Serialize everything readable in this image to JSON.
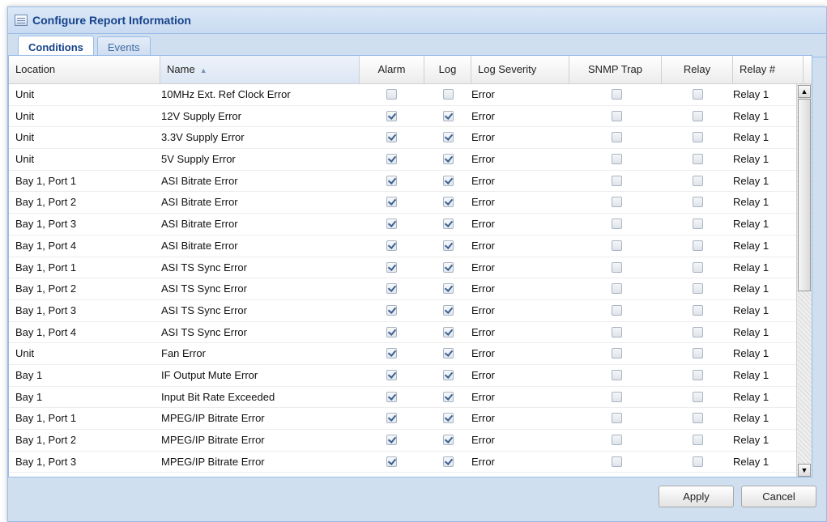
{
  "window": {
    "title": "Configure Report Information"
  },
  "tabs": [
    {
      "label": "Conditions",
      "active": true
    },
    {
      "label": "Events",
      "active": false
    }
  ],
  "grid": {
    "columns": [
      {
        "key": "location",
        "label": "Location"
      },
      {
        "key": "name",
        "label": "Name",
        "sorted": "asc"
      },
      {
        "key": "alarm",
        "label": "Alarm"
      },
      {
        "key": "log",
        "label": "Log"
      },
      {
        "key": "severity",
        "label": "Log Severity"
      },
      {
        "key": "snmp",
        "label": "SNMP Trap"
      },
      {
        "key": "relay",
        "label": "Relay"
      },
      {
        "key": "relay_num",
        "label": "Relay #"
      }
    ],
    "rows": [
      {
        "location": "Unit",
        "name": "10MHz Ext. Ref Clock Error",
        "alarm": false,
        "log": false,
        "severity": "Error",
        "snmp": false,
        "relay": false,
        "relay_num": "Relay 1"
      },
      {
        "location": "Unit",
        "name": "12V Supply Error",
        "alarm": true,
        "log": true,
        "severity": "Error",
        "snmp": false,
        "relay": false,
        "relay_num": "Relay 1"
      },
      {
        "location": "Unit",
        "name": "3.3V Supply Error",
        "alarm": true,
        "log": true,
        "severity": "Error",
        "snmp": false,
        "relay": false,
        "relay_num": "Relay 1"
      },
      {
        "location": "Unit",
        "name": "5V Supply Error",
        "alarm": true,
        "log": true,
        "severity": "Error",
        "snmp": false,
        "relay": false,
        "relay_num": "Relay 1"
      },
      {
        "location": "Bay 1, Port 1",
        "name": "ASI Bitrate Error",
        "alarm": true,
        "log": true,
        "severity": "Error",
        "snmp": false,
        "relay": false,
        "relay_num": "Relay 1"
      },
      {
        "location": "Bay 1, Port 2",
        "name": "ASI Bitrate Error",
        "alarm": true,
        "log": true,
        "severity": "Error",
        "snmp": false,
        "relay": false,
        "relay_num": "Relay 1"
      },
      {
        "location": "Bay 1, Port 3",
        "name": "ASI Bitrate Error",
        "alarm": true,
        "log": true,
        "severity": "Error",
        "snmp": false,
        "relay": false,
        "relay_num": "Relay 1"
      },
      {
        "location": "Bay 1, Port 4",
        "name": "ASI Bitrate Error",
        "alarm": true,
        "log": true,
        "severity": "Error",
        "snmp": false,
        "relay": false,
        "relay_num": "Relay 1"
      },
      {
        "location": "Bay 1, Port 1",
        "name": "ASI TS Sync Error",
        "alarm": true,
        "log": true,
        "severity": "Error",
        "snmp": false,
        "relay": false,
        "relay_num": "Relay 1"
      },
      {
        "location": "Bay 1, Port 2",
        "name": "ASI TS Sync Error",
        "alarm": true,
        "log": true,
        "severity": "Error",
        "snmp": false,
        "relay": false,
        "relay_num": "Relay 1"
      },
      {
        "location": "Bay 1, Port 3",
        "name": "ASI TS Sync Error",
        "alarm": true,
        "log": true,
        "severity": "Error",
        "snmp": false,
        "relay": false,
        "relay_num": "Relay 1"
      },
      {
        "location": "Bay 1, Port 4",
        "name": "ASI TS Sync Error",
        "alarm": true,
        "log": true,
        "severity": "Error",
        "snmp": false,
        "relay": false,
        "relay_num": "Relay 1"
      },
      {
        "location": "Unit",
        "name": "Fan Error",
        "alarm": true,
        "log": true,
        "severity": "Error",
        "snmp": false,
        "relay": false,
        "relay_num": "Relay 1"
      },
      {
        "location": "Bay 1",
        "name": "IF Output Mute Error",
        "alarm": true,
        "log": true,
        "severity": "Error",
        "snmp": false,
        "relay": false,
        "relay_num": "Relay 1"
      },
      {
        "location": "Bay 1",
        "name": "Input Bit Rate Exceeded",
        "alarm": true,
        "log": true,
        "severity": "Error",
        "snmp": false,
        "relay": false,
        "relay_num": "Relay 1"
      },
      {
        "location": "Bay 1, Port 1",
        "name": "MPEG/IP Bitrate Error",
        "alarm": true,
        "log": true,
        "severity": "Error",
        "snmp": false,
        "relay": false,
        "relay_num": "Relay 1"
      },
      {
        "location": "Bay 1, Port 2",
        "name": "MPEG/IP Bitrate Error",
        "alarm": true,
        "log": true,
        "severity": "Error",
        "snmp": false,
        "relay": false,
        "relay_num": "Relay 1"
      },
      {
        "location": "Bay 1, Port 3",
        "name": "MPEG/IP Bitrate Error",
        "alarm": true,
        "log": true,
        "severity": "Error",
        "snmp": false,
        "relay": false,
        "relay_num": "Relay 1"
      }
    ]
  },
  "buttons": {
    "apply": "Apply",
    "cancel": "Cancel"
  }
}
